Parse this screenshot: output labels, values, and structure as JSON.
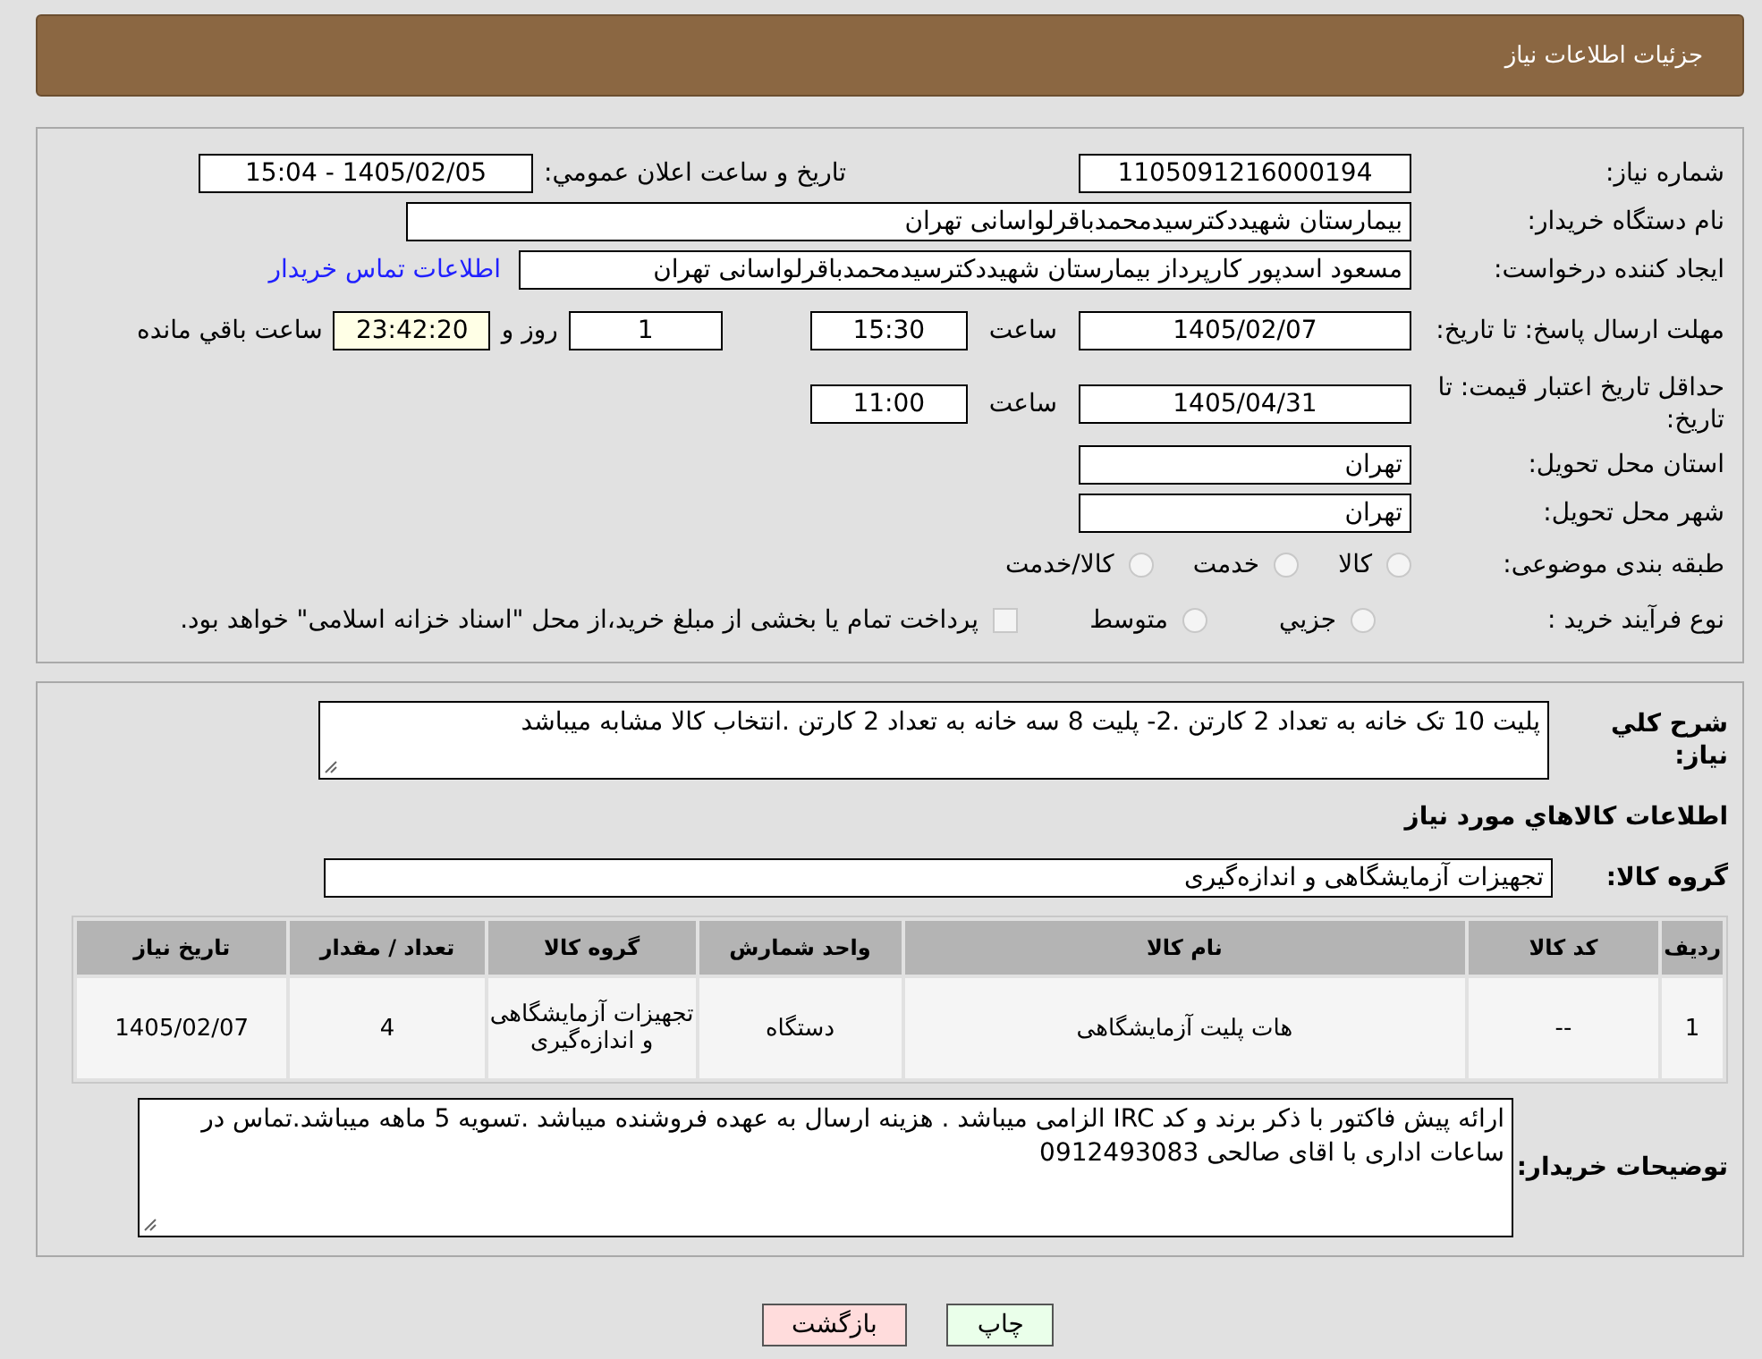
{
  "header": {
    "title": "جزئیات اطلاعات نیاز"
  },
  "details": {
    "need_number": {
      "label": "شماره نیاز:",
      "value": "1105091216000194"
    },
    "announce": {
      "label": "تاریخ و ساعت اعلان عمومي:",
      "value": "1405/02/05 - 15:04"
    },
    "buyer": {
      "label": "نام دستگاه خریدار:",
      "value": "بیمارستان شهیددکترسیدمحمدباقرلواسانی تهران"
    },
    "creator": {
      "label": "ایجاد کننده درخواست:",
      "value": "مسعود اسدپور کارپرداز بیمارستان شهیددکترسیدمحمدباقرلواسانی تهران",
      "link": "اطلاعات تماس خریدار"
    },
    "deadline": {
      "label": "مهلت ارسال پاسخ: تا تاریخ:",
      "date": "1405/02/07",
      "time_label": "ساعت",
      "time": "15:30",
      "days": "1",
      "days_label": "روز و",
      "remaining": "23:42:20",
      "remaining_label": "ساعت باقي مانده"
    },
    "validity": {
      "label": "حداقل تاریخ اعتبار قیمت: تا تاریخ:",
      "date": "1405/04/31",
      "time_label": "ساعت",
      "time": "11:00"
    },
    "province": {
      "label": "استان محل تحویل:",
      "value": "تهران"
    },
    "city": {
      "label": "شهر محل تحویل:",
      "value": "تهران"
    },
    "category": {
      "label": "طبقه بندی موضوعی:",
      "options": [
        {
          "label": "کالا",
          "selected": false
        },
        {
          "label": "خدمت",
          "selected": false
        },
        {
          "label": "کالا/خدمت",
          "selected": false
        }
      ]
    },
    "process": {
      "label": "نوع فرآیند خرید :",
      "options": [
        {
          "label": "جزيي",
          "selected": false
        },
        {
          "label": "متوسط",
          "selected": false
        }
      ],
      "payment": {
        "label": "پرداخت تمام یا بخشی از مبلغ خرید،از محل \"اسناد خزانه اسلامی\" خواهد بود.",
        "checked": false
      }
    }
  },
  "goods": {
    "description": {
      "label": "شرح کلي نیاز:",
      "value": "پلیت 10 تک خانه به تعداد 2 کارتن .2- پلیت 8 سه خانه به تعداد 2 کارتن .انتخاب کالا مشابه میباشد"
    },
    "heading": "اطلاعات کالاهاي مورد نیاز",
    "group": {
      "label": "گروه کالا:",
      "value": "تجهیزات آزمایشگاهی و اندازه‌گیری"
    },
    "table": {
      "columns": [
        "ردیف",
        "کد کالا",
        "نام کالا",
        "واحد شمارش",
        "گروه کالا",
        "تعداد / مقدار",
        "تاریخ نیاز"
      ],
      "rows": [
        [
          "1",
          "--",
          "هات پلیت آزمایشگاهی",
          "دستگاه",
          "تجهیزات آزمایشگاهی و اندازه‌گیری",
          "4",
          "1405/02/07"
        ]
      ]
    },
    "notes": {
      "label": "توضیحات خریدار:",
      "value": "ارائه پیش فاکتور با ذکر برند و کد IRC الزامی میباشد . هزینه ارسال به عهده فروشنده میباشد .تسویه 5 ماهه میباشد.تماس در ساعات اداری با اقای صالحی 0912493083"
    }
  },
  "buttons": [
    {
      "label": "چاپ",
      "kind": "print"
    },
    {
      "label": "بازگشت",
      "kind": "back"
    }
  ]
}
